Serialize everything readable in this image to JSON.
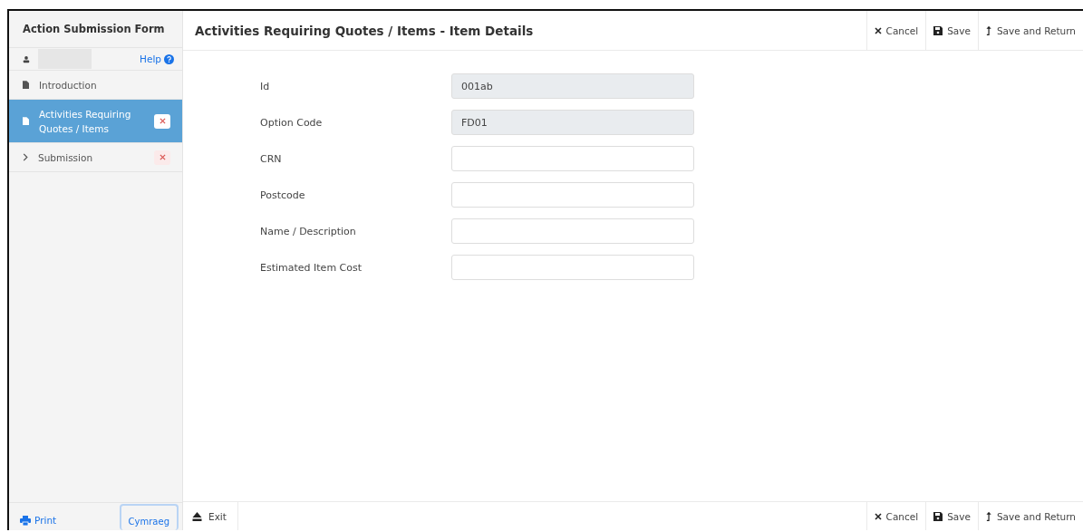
{
  "sidebar": {
    "title": "Action Submission Form",
    "help": "Help",
    "items": [
      {
        "kind": "doc",
        "label": "Introduction",
        "selected": false,
        "invalid": false
      },
      {
        "kind": "doc",
        "label": "Activities Requiring Quotes / Items",
        "selected": true,
        "invalid": true
      },
      {
        "kind": "chevron",
        "label": "Submission",
        "selected": false,
        "invalid": true
      }
    ],
    "footer": {
      "print": "Print",
      "language": "Cymraeg"
    }
  },
  "header": {
    "title": "Activities Requiring Quotes / Items - Item Details",
    "actions": [
      {
        "kind": "cancel",
        "label": "Cancel"
      },
      {
        "kind": "save",
        "label": "Save"
      },
      {
        "kind": "return",
        "label": "Save and Return"
      }
    ]
  },
  "fields": [
    {
      "label": "Id",
      "value": "001ab",
      "disabled": true
    },
    {
      "label": "Option Code",
      "value": "FD01",
      "disabled": true
    },
    {
      "label": "CRN",
      "disabled": false
    },
    {
      "label": "Postcode",
      "disabled": false
    },
    {
      "label": "Name / Description",
      "disabled": false
    },
    {
      "label": "Estimated Item Cost",
      "disabled": false
    }
  ],
  "footer": {
    "exit": "Exit",
    "actions": [
      {
        "kind": "cancel",
        "label": "Cancel"
      },
      {
        "kind": "save",
        "label": "Save"
      },
      {
        "kind": "return",
        "label": "Save and Return"
      }
    ]
  }
}
